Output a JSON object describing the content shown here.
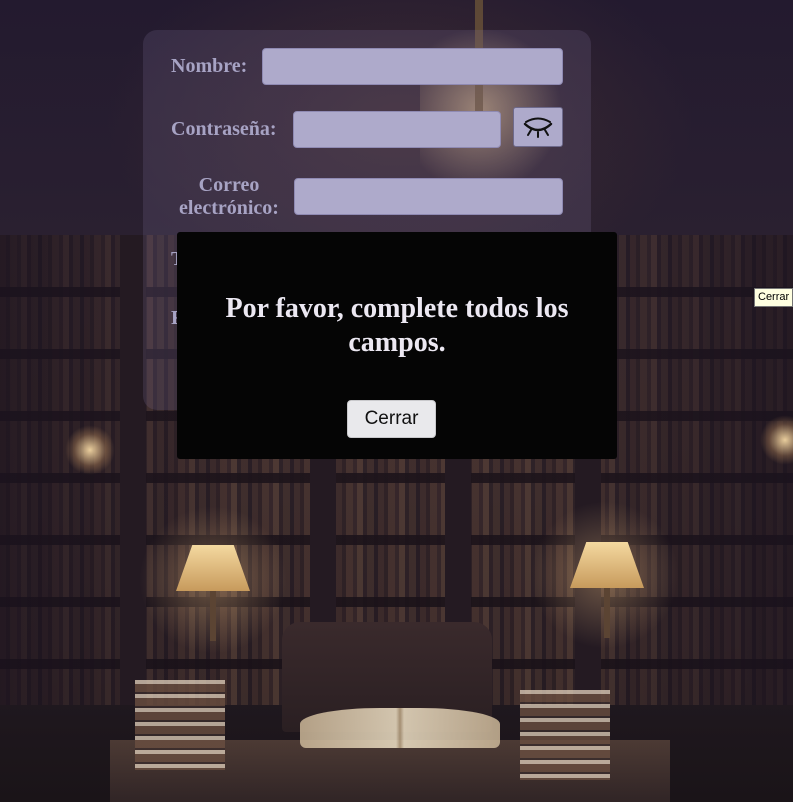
{
  "form": {
    "name_label": "Nombre:",
    "password_label": "Contraseña:",
    "email_label_line1": "Correo",
    "email_label_line2": "electrónico:",
    "partial_label_1": "T",
    "partial_label_2": "F",
    "name_value": "",
    "password_value": "",
    "email_value": "",
    "toggle_icon": "eye-closed-icon"
  },
  "modal": {
    "message": "Por favor, complete todos los campos.",
    "close_label": "Cerrar"
  },
  "tooltip": {
    "text": "Cerrar"
  },
  "colors": {
    "card_bg": "#7d6e96",
    "field_bg": "#aeaacb",
    "label_text": "#a7a3c4",
    "modal_bg": "#050505",
    "modal_text": "#ece8f2"
  }
}
